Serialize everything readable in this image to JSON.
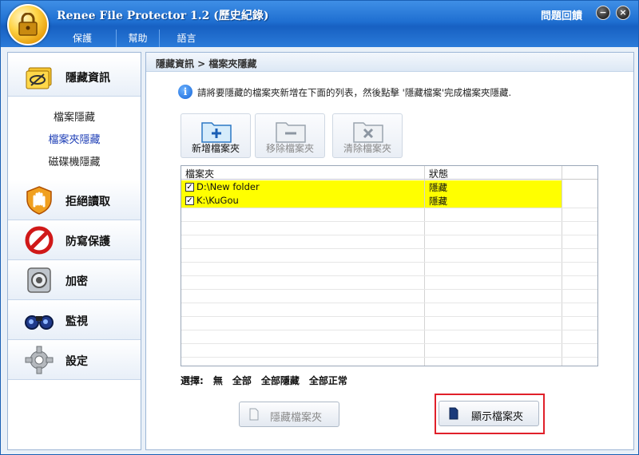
{
  "window": {
    "title": "Renee File Protector 1.2 (歷史紀錄)",
    "feedback_label": "問題回饋",
    "minimize_glyph": "−",
    "close_glyph": "×"
  },
  "menu": [
    {
      "label": "保護"
    },
    {
      "label": "幫助"
    },
    {
      "label": "語言"
    }
  ],
  "sidebar": {
    "sections": [
      {
        "label": "隱藏資訊",
        "icon": "hide-info-icon"
      },
      {
        "label": "拒絕讀取",
        "icon": "hand-shield-icon"
      },
      {
        "label": "防寫保護",
        "icon": "no-entry-icon"
      },
      {
        "label": "加密",
        "icon": "safe-icon"
      },
      {
        "label": "監視",
        "icon": "binoculars-icon"
      },
      {
        "label": "設定",
        "icon": "gear-icon"
      }
    ],
    "sub_items": [
      {
        "label": "檔案隱藏",
        "active": false
      },
      {
        "label": "檔案夾隱藏",
        "active": true
      },
      {
        "label": "磁碟機隱藏",
        "active": false
      }
    ]
  },
  "main": {
    "breadcrumb": "隱藏資訊 > 檔案夾隱藏",
    "info_text": "請將要隱藏的檔案夾新增在下面的列表，然後點擊 '隱藏檔案'完成檔案夾隱藏.",
    "toolbar": {
      "add_label": "新增檔案夾",
      "remove_label": "移除檔案夾",
      "clear_label": "清除檔案夾"
    },
    "table": {
      "columns": [
        "檔案夾",
        "狀態"
      ],
      "rows": [
        {
          "checked": true,
          "folder": "D:\\New folder",
          "status": "隱藏"
        },
        {
          "checked": true,
          "folder": "K:\\KuGou",
          "status": "隱藏"
        }
      ]
    },
    "select": {
      "label": "選擇:",
      "none": "無",
      "all": "全部",
      "all_hidden": "全部隱藏",
      "all_normal": "全部正常"
    },
    "hide_button": "隱藏檔案夾",
    "show_button": "顯示檔案夾"
  },
  "colors": {
    "title_bar": "#1f6fd1",
    "row_highlight": "#ffff00",
    "annotation_box": "#e0202a"
  }
}
